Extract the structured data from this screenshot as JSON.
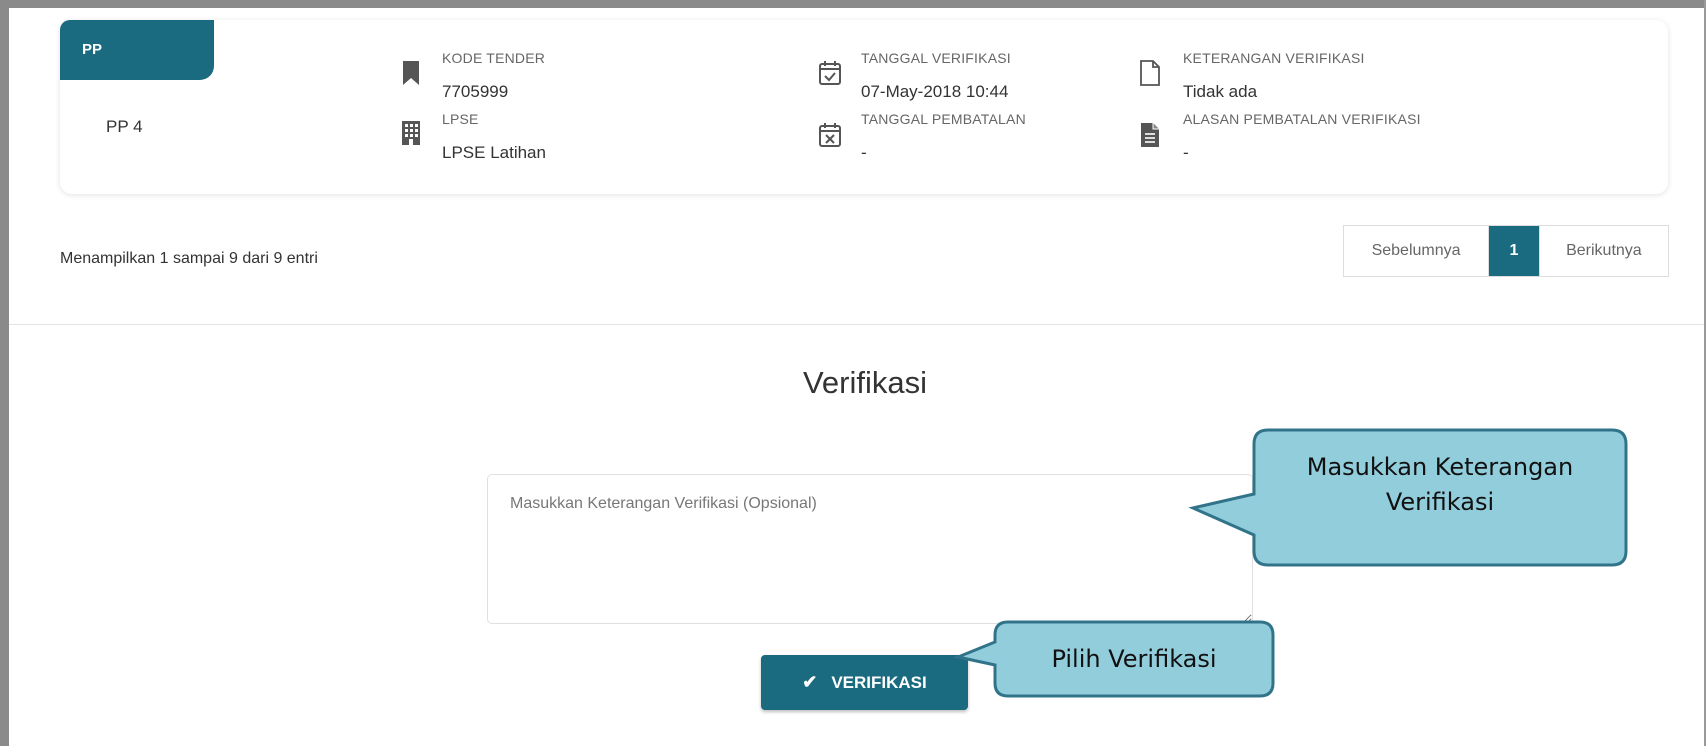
{
  "pp": {
    "tab_label": "PP",
    "value": "PP 4"
  },
  "info": {
    "kode_tender": {
      "label": "KODE TENDER",
      "value": "7705999"
    },
    "lpse": {
      "label": "LPSE",
      "value": "LPSE Latihan"
    },
    "tanggal_verifikasi": {
      "label": "TANGGAL VERIFIKASI",
      "value": "07-May-2018 10:44"
    },
    "tanggal_pembatalan": {
      "label": "TANGGAL PEMBATALAN",
      "value": "-"
    },
    "keterangan_verifikasi": {
      "label": "KETERANGAN VERIFIKASI",
      "value": "Tidak ada"
    },
    "alasan_pembatalan": {
      "label": "ALASAN PEMBATALAN VERIFIKASI",
      "value": "-"
    }
  },
  "entries_text": "Menampilkan 1 sampai 9 dari 9 entri",
  "pagination": {
    "prev": "Sebelumnya",
    "current": "1",
    "next": "Berikutnya"
  },
  "verifikasi": {
    "title": "Verifikasi",
    "input_value": "",
    "input_placeholder": "Masukkan Keterangan Verifikasi (Opsional)",
    "button_label": "VERIFIKASI"
  },
  "callouts": {
    "keterangan_line1": "Masukkan Keterangan",
    "keterangan_line2": "Verifikasi",
    "pilih": "Pilih Verifikasi"
  },
  "colors": {
    "primary": "#1a6a80",
    "callout_fill": "#92cddc",
    "callout_border": "#31748a"
  },
  "icons": {
    "kode_tender": "bookmark-icon",
    "lpse": "building-icon",
    "tanggal_verifikasi": "calendar-check-icon",
    "tanggal_pembatalan": "calendar-x-icon",
    "keterangan_verifikasi": "document-icon",
    "alasan_pembatalan": "document-text-icon",
    "button": "check-icon"
  }
}
